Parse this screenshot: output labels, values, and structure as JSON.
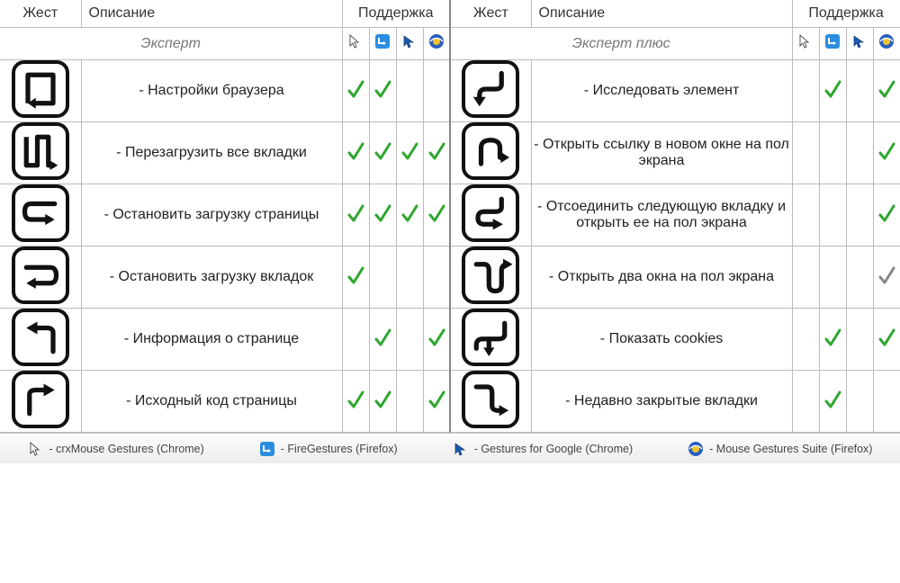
{
  "headers": {
    "gesture": "Жест",
    "description": "Описание",
    "support": "Поддержка"
  },
  "left": {
    "group": "Эксперт",
    "rows": [
      {
        "desc": "Настройки браузера",
        "support": [
          true,
          true,
          false,
          false
        ]
      },
      {
        "desc": "Перезагрузить все вкладки",
        "support": [
          true,
          true,
          true,
          true
        ]
      },
      {
        "desc": "Остановить загрузку страницы",
        "support": [
          true,
          true,
          true,
          true
        ]
      },
      {
        "desc": "Остановить загрузку вкладок",
        "support": [
          true,
          false,
          false,
          false
        ]
      },
      {
        "desc": "Информация о странице",
        "support": [
          false,
          true,
          false,
          true
        ]
      },
      {
        "desc": "Исходный код страницы",
        "support": [
          true,
          true,
          false,
          true
        ]
      }
    ]
  },
  "right": {
    "group": "Эксперт плюс",
    "rows": [
      {
        "desc": "Исследовать элемент",
        "support": [
          false,
          true,
          false,
          true
        ]
      },
      {
        "desc": "Открыть ссылку в новом окне на пол экрана",
        "support": [
          false,
          false,
          false,
          true
        ]
      },
      {
        "desc": "Отсоединить следующую вкладку и открыть ее на пол экрана",
        "support": [
          false,
          false,
          false,
          true
        ]
      },
      {
        "desc": "Открыть два окна на пол экрана",
        "support": [
          false,
          false,
          false,
          "grey"
        ]
      },
      {
        "desc": "Показать cookies",
        "support": [
          false,
          true,
          false,
          true
        ]
      },
      {
        "desc": "Недавно закрытые вкладки",
        "support": [
          false,
          true,
          false,
          false
        ]
      }
    ]
  },
  "legend": [
    {
      "key": "crxmouse",
      "label": "crxMouse Gestures (Chrome)"
    },
    {
      "key": "firegestures",
      "label": "FireGestures (Firefox)"
    },
    {
      "key": "gfg",
      "label": "Gestures for Google (Chrome)"
    },
    {
      "key": "mgs",
      "label": "Mouse Gestures Suite (Firefox)"
    }
  ]
}
